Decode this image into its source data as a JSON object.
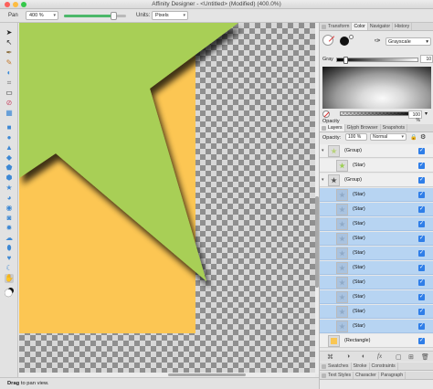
{
  "window": {
    "title": "Affinity Designer - <Untitled> (Modified) (400.0%)",
    "traffic_colors": [
      "#fc605b",
      "#fdbc40",
      "#34c84a"
    ]
  },
  "context_toolbar": {
    "tool_label": "Pan",
    "zoom_value": "400 %",
    "zoom_slider_fraction": 0.8,
    "units_label": "Units:",
    "units_value": "Pixels"
  },
  "tools": [
    "move-tool",
    "node-tool",
    "artboard-tool",
    "pen-tool",
    "pencil-tool",
    "vector-brush-tool",
    "fill-tool",
    "transparency-tool",
    "crop-tool",
    "place-tool",
    "rectangle-tool",
    "ellipse-tool",
    "rounded-rectangle-tool",
    "triangle-tool",
    "diamond-tool",
    "pentagon-tool",
    "polygon-tool",
    "star-tool",
    "pie-tool",
    "donut-tool",
    "square-star-tool",
    "double-star-tool",
    "callout-tool",
    "callout-ellipse-tool",
    "cog-tool",
    "crescent-tool",
    "tear-tool",
    "heart-tool",
    "cloud-tool",
    "arrow-tool",
    "text-tool",
    "hand-tool",
    "zoom-tool"
  ],
  "status_bar": {
    "bold": "Drag",
    "text": "to pan view."
  },
  "color_panel": {
    "tabs": [
      "Transform",
      "Color",
      "Navigator",
      "History"
    ],
    "active_tab": "Color",
    "fill_color": "#ffffff",
    "stroke_color": "#111111",
    "mode": "Grayscale",
    "gray_label": "Gray",
    "gray_value": "10",
    "gray_fraction": 0.1,
    "opacity_label": "Opacity",
    "opacity_value": "100 %"
  },
  "layers_panel": {
    "tabs": [
      "Layers",
      "Glyph Browser",
      "Snapshots"
    ],
    "active_tab": "Layers",
    "opacity_label": "Opacity:",
    "opacity_value": "100 %",
    "blend_mode": "Normal",
    "rows": [
      {
        "name": "(Group)",
        "indent": 0,
        "selected": false,
        "thumb": "#b8d27a",
        "expanded": true
      },
      {
        "name": "(Star)",
        "indent": 1,
        "selected": false,
        "thumb": "#9ccf54"
      },
      {
        "name": "(Group)",
        "indent": 0,
        "selected": false,
        "thumb": "#555555",
        "expanded": true
      },
      {
        "name": "(Star)",
        "indent": 1,
        "selected": true,
        "thumb": "#8faac7"
      },
      {
        "name": "(Star)",
        "indent": 1,
        "selected": true,
        "thumb": "#8faac7"
      },
      {
        "name": "(Star)",
        "indent": 1,
        "selected": true,
        "thumb": "#8faac7"
      },
      {
        "name": "(Star)",
        "indent": 1,
        "selected": true,
        "thumb": "#8faac7"
      },
      {
        "name": "(Star)",
        "indent": 1,
        "selected": true,
        "thumb": "#8faac7"
      },
      {
        "name": "(Star)",
        "indent": 1,
        "selected": true,
        "thumb": "#8faac7"
      },
      {
        "name": "(Star)",
        "indent": 1,
        "selected": true,
        "thumb": "#8faac7"
      },
      {
        "name": "(Star)",
        "indent": 1,
        "selected": true,
        "thumb": "#8faac7"
      },
      {
        "name": "(Star)",
        "indent": 1,
        "selected": true,
        "thumb": "#8faac7"
      },
      {
        "name": "(Star)",
        "indent": 1,
        "selected": true,
        "thumb": "#8faac7"
      },
      {
        "name": "(Rectangle)",
        "indent": 0,
        "selected": false,
        "thumb": "#f9c653"
      }
    ]
  },
  "bottom_tabs_1": [
    "Swatches",
    "Stroke",
    "Constraints"
  ],
  "bottom_tabs_2": [
    "Text Styles",
    "Character",
    "Paragraph"
  ],
  "canvas": {
    "rectangle_color": "#fcc653",
    "star_color": "#a8cf56",
    "shadow_color": "#4a3a20"
  }
}
